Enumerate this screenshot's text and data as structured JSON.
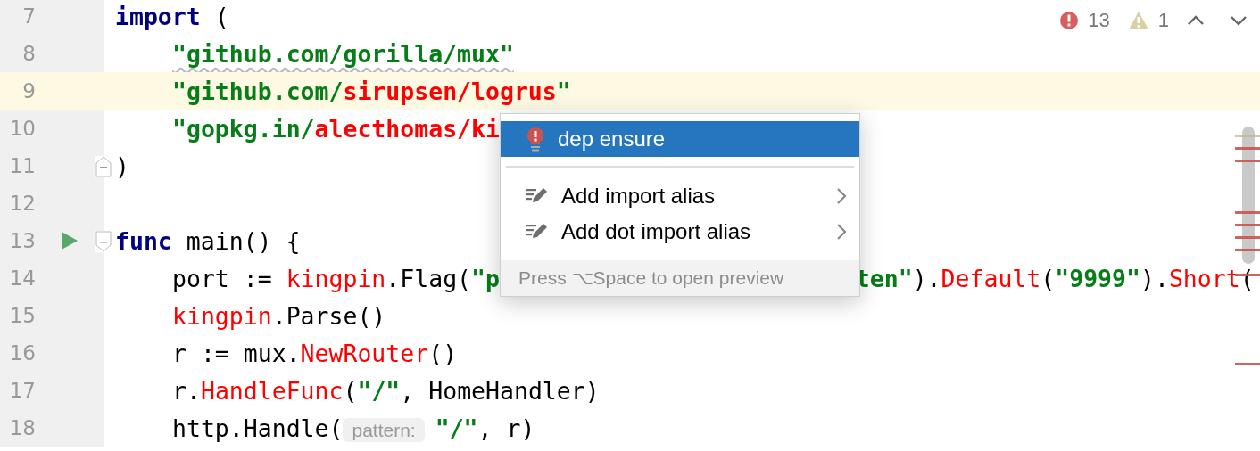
{
  "inspections": {
    "errors": "13",
    "warnings": "1"
  },
  "lines": [
    {
      "number": "7",
      "kind": "code",
      "current": false,
      "segments": [
        {
          "text": "import",
          "kind": "keyword"
        },
        {
          "text": " (",
          "kind": "plain"
        }
      ],
      "children": [
        {
          "number": "8",
          "kind": "code",
          "current": false,
          "segments": [
            {
              "text": "\"github.com/gorilla/mux\"",
              "kind": "string",
              "squiggly": true
            }
          ]
        },
        {
          "number": "9",
          "kind": "code",
          "current": true,
          "segments": [
            {
              "text": "\"github.com/",
              "kind": "string"
            },
            {
              "text": "sirupsen/logrus",
              "kind": "unresolved-string"
            },
            {
              "text": "\"",
              "kind": "string"
            }
          ]
        },
        {
          "number": "10",
          "kind": "code",
          "current": false,
          "segments": [
            {
              "text": "\"gopkg.in/",
              "kind": "string"
            },
            {
              "text": "alecthomas/ki",
              "kind": "unresolved-string"
            }
          ]
        }
      ]
    },
    {
      "number": "11",
      "kind": "fold-end",
      "current": false,
      "segments": [
        {
          "text": ")",
          "kind": "plain"
        }
      ]
    },
    {
      "number": "12",
      "kind": "code",
      "current": false
    },
    {
      "number": "13",
      "kind": "fold-start",
      "current": false,
      "run": true,
      "segments": [
        {
          "text": "func",
          "kind": "keyword"
        },
        {
          "text": " main() {",
          "kind": "plain"
        }
      ],
      "children": [
        {
          "number": "14",
          "kind": "code",
          "current": false,
          "segments": [
            {
              "text": "port := ",
              "kind": "plain"
            },
            {
              "text": "kingpin",
              "kind": "unresolved"
            },
            {
              "text": ".Flag(",
              "kind": "plain"
            },
            {
              "text": "\"p",
              "kind": "string"
            },
            {
              "kind": "covered"
            },
            {
              "text": "ten\"",
              "kind": "string"
            },
            {
              "text": ").",
              "kind": "plain"
            },
            {
              "text": "Default",
              "kind": "unresolved"
            },
            {
              "text": "(",
              "kind": "plain"
            },
            {
              "text": "\"9999\"",
              "kind": "string"
            },
            {
              "text": ").",
              "kind": "plain"
            },
            {
              "text": "Short",
              "kind": "unresolved"
            },
            {
              "text": "(",
              "kind": "plain"
            }
          ]
        },
        {
          "number": "15",
          "kind": "code",
          "current": false,
          "segments": [
            {
              "text": "kingpin",
              "kind": "unresolved"
            },
            {
              "text": ".Parse()",
              "kind": "plain"
            }
          ]
        },
        {
          "number": "16",
          "kind": "code",
          "current": false,
          "segments": [
            {
              "text": "r := mux.",
              "kind": "plain"
            },
            {
              "text": "NewRouter",
              "kind": "unresolved"
            },
            {
              "text": "()",
              "kind": "plain"
            }
          ]
        },
        {
          "number": "17",
          "kind": "code",
          "current": false,
          "segments": [
            {
              "text": "r.",
              "kind": "plain"
            },
            {
              "text": "HandleFunc",
              "kind": "unresolved"
            },
            {
              "text": "(",
              "kind": "plain"
            },
            {
              "text": "\"/\"",
              "kind": "string"
            },
            {
              "text": ", HomeHandler)",
              "kind": "plain"
            }
          ]
        },
        {
          "number": "18",
          "kind": "code",
          "current": false,
          "segments": [
            {
              "text": "http.Handle(",
              "kind": "plain"
            },
            {
              "text": "pattern:",
              "kind": "hint"
            },
            {
              "text": "\"/\"",
              "kind": "string"
            },
            {
              "text": ", r)",
              "kind": "plain"
            }
          ]
        }
      ]
    }
  ],
  "popup": {
    "items": [
      {
        "label": "dep ensure",
        "kind": "quick-fix",
        "selected": true,
        "submenu": false
      },
      {
        "kind": "separator"
      },
      {
        "label": "Add import alias",
        "kind": "intention",
        "selected": false,
        "submenu": true
      },
      {
        "label": "Add dot import alias",
        "kind": "intention",
        "selected": false,
        "submenu": true
      }
    ],
    "footer": "Press ⌥Space to open preview"
  }
}
